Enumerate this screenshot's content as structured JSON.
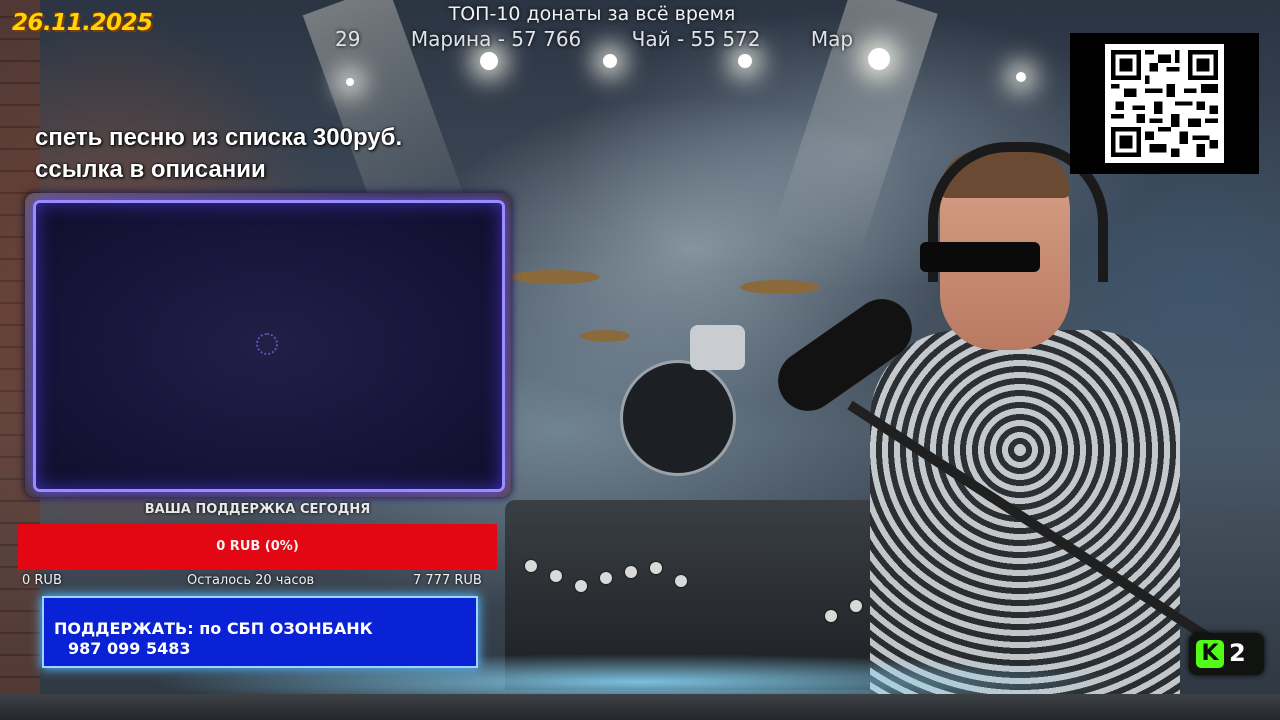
{
  "date": "26.11.2025",
  "top_donations": {
    "title": "ТОП-10 донаты за всё время",
    "ticker": [
      "29",
      "Марина - 57 766",
      "Чай - 55 572",
      "Мар"
    ]
  },
  "promo": {
    "line1": "спеть песню из списка 300руб.",
    "line2": "ссылка в описании"
  },
  "donation_goal": {
    "title": "ВАША ПОДДЕРЖКА СЕГОДНЯ",
    "value_label": "0 RUB (0%)",
    "progress": 0,
    "min_label": "0 RUB",
    "time_left": "Осталось 20 часов",
    "max_label": "7 777 RUB",
    "bar_color": "#e30613"
  },
  "support": {
    "line1": "ПОДДЕРЖАТЬ: по СБП ОЗОНБАНК",
    "line2": "987 099 5483"
  },
  "kick": {
    "logo_letter": "K",
    "viewer_count": "2",
    "brand_color": "#53fc18"
  },
  "colors": {
    "date_text": "#ffd400",
    "support_bg": "#0a22d6",
    "webcam_glow": "#5e4cff"
  }
}
